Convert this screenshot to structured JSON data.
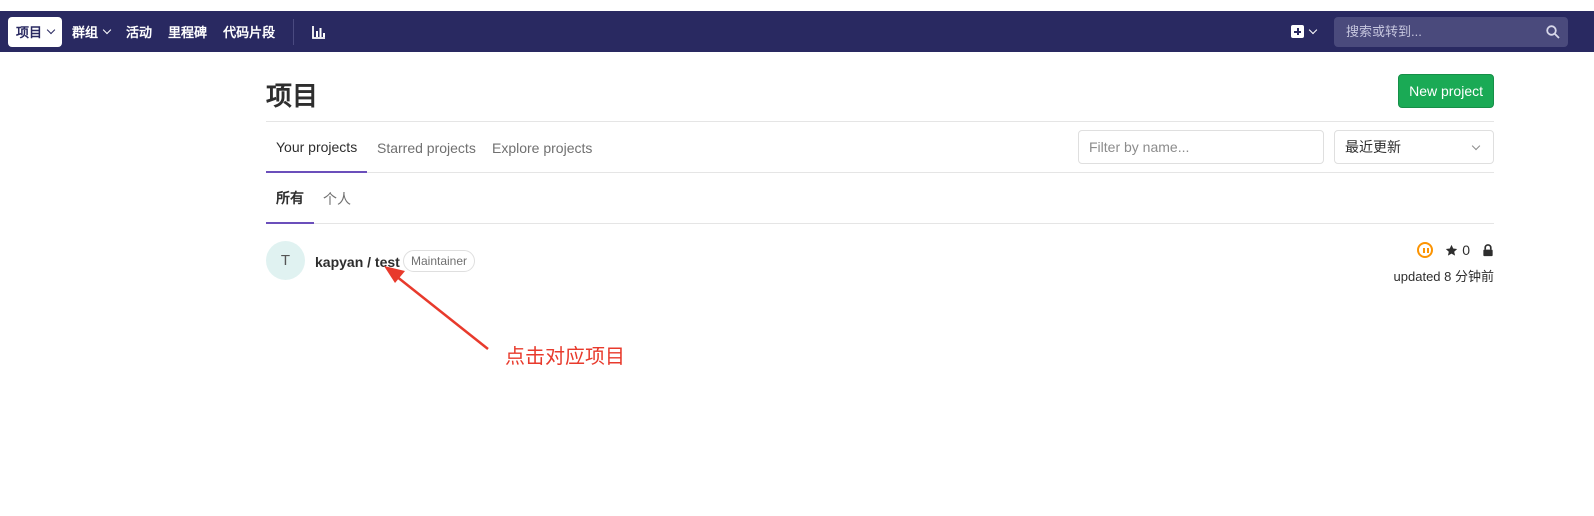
{
  "navbar": {
    "projects_label": "项目",
    "groups_label": "群组",
    "activity_label": "活动",
    "milestones_label": "里程碑",
    "snippets_label": "代码片段",
    "search_placeholder": "搜索或转到..."
  },
  "page": {
    "title": "项目",
    "new_project_label": "New project"
  },
  "tabs": {
    "your_projects": "Your projects",
    "starred_projects": "Starred projects",
    "explore_projects": "Explore projects"
  },
  "filter": {
    "placeholder": "Filter by name...",
    "sort_value": "最近更新"
  },
  "subtabs": {
    "all": "所有",
    "personal": "个人"
  },
  "project": {
    "avatar_letter": "T",
    "name": "kapyan / test",
    "role": "Maintainer",
    "stars": "0",
    "updated": "updated 8 分钟前"
  },
  "annotation": {
    "text": "点击对应项目",
    "color": "#e83a2c"
  },
  "colors": {
    "navbar_bg": "#292961",
    "primary_button": "#1aaa55",
    "tab_underline": "#6b4fbb",
    "pipeline_status": "#fc9403"
  }
}
